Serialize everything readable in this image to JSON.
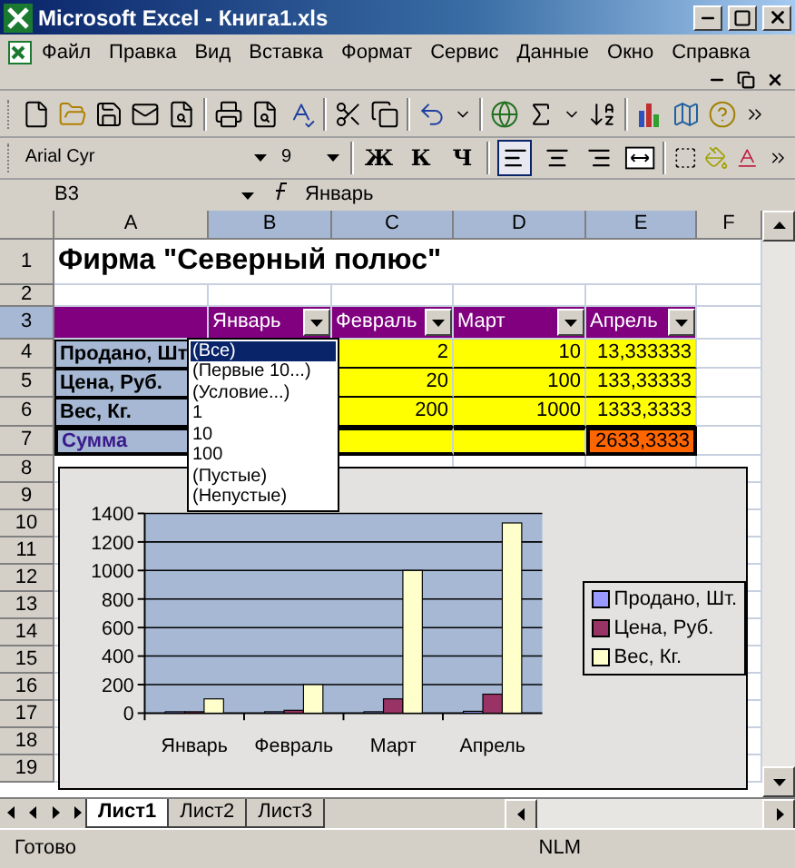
{
  "window": {
    "title": "Microsoft Excel - Книга1.xls"
  },
  "menu": [
    "Файл",
    "Правка",
    "Вид",
    "Вставка",
    "Формат",
    "Сервис",
    "Данные",
    "Окно",
    "Справка"
  ],
  "format_toolbar": {
    "font": "Arial Cyr",
    "size": "9",
    "style_buttons": [
      "Ж",
      "К",
      "Ч"
    ],
    "align": [
      {
        "kind": "left",
        "selected": true
      },
      {
        "kind": "center",
        "selected": false
      },
      {
        "kind": "right",
        "selected": false
      }
    ]
  },
  "formula_bar": {
    "name_box": "B3",
    "value": "Январь"
  },
  "sheet": {
    "columns": [
      {
        "label": "A",
        "selected": false
      },
      {
        "label": "B",
        "selected": true
      },
      {
        "label": "C",
        "selected": true
      },
      {
        "label": "D",
        "selected": true
      },
      {
        "label": "E",
        "selected": true
      },
      {
        "label": "F",
        "selected": false
      }
    ],
    "rows": [
      {
        "number": "1",
        "selected": false,
        "cells": [
          {
            "kind": "title",
            "text": "Фирма \"Северный полюс\""
          }
        ]
      },
      {
        "number": "2",
        "selected": false
      },
      {
        "number": "3",
        "selected": true,
        "cells": [
          {
            "kind": "header-fill"
          },
          {
            "kind": "filter-header",
            "text": "Январь"
          },
          {
            "kind": "filter-header",
            "text": "Февраль"
          },
          {
            "kind": "filter-header",
            "text": "Март"
          },
          {
            "kind": "filter-header",
            "text": "Апрель"
          }
        ]
      },
      {
        "number": "4",
        "selected": false,
        "cells": [
          {
            "kind": "label",
            "text": "Продано, Шт"
          },
          {
            "kind": "covered"
          },
          {
            "kind": "value",
            "text": "2"
          },
          {
            "kind": "value",
            "text": "10"
          },
          {
            "kind": "value",
            "text": "13,333333"
          }
        ]
      },
      {
        "number": "5",
        "selected": false,
        "cells": [
          {
            "kind": "label",
            "text": "Цена, Руб."
          },
          {
            "kind": "covered"
          },
          {
            "kind": "value",
            "text": "20"
          },
          {
            "kind": "value",
            "text": "100"
          },
          {
            "kind": "value",
            "text": "133,33333"
          }
        ]
      },
      {
        "number": "6",
        "selected": false,
        "cells": [
          {
            "kind": "label",
            "text": "Вес, Кг."
          },
          {
            "kind": "covered"
          },
          {
            "kind": "value",
            "text": "200"
          },
          {
            "kind": "value",
            "text": "1000"
          },
          {
            "kind": "value",
            "text": "1333,3333"
          }
        ]
      },
      {
        "number": "7",
        "selected": false,
        "cells": [
          {
            "kind": "sum-label",
            "text": "Сумма"
          },
          {
            "kind": "covered"
          },
          {
            "kind": "sum-fill"
          },
          {
            "kind": "sum-fill"
          },
          {
            "kind": "sum-value",
            "text": "2633,3333"
          }
        ]
      },
      {
        "number": "8",
        "selected": false
      },
      {
        "number": "9",
        "selected": false
      },
      {
        "number": "10",
        "selected": false
      },
      {
        "number": "11",
        "selected": false
      },
      {
        "number": "12",
        "selected": false
      },
      {
        "number": "13",
        "selected": false
      },
      {
        "number": "14",
        "selected": false
      },
      {
        "number": "15",
        "selected": false
      },
      {
        "number": "16",
        "selected": false
      },
      {
        "number": "17",
        "selected": false
      },
      {
        "number": "18",
        "selected": false
      },
      {
        "number": "19",
        "selected": false
      }
    ]
  },
  "autofilter_list": {
    "items": [
      {
        "text": "(Все)",
        "selected": true
      },
      {
        "text": "(Первые 10...)",
        "selected": false
      },
      {
        "text": "(Условие...)",
        "selected": false
      },
      {
        "text": "1",
        "selected": false
      },
      {
        "text": "10",
        "selected": false
      },
      {
        "text": "100",
        "selected": false
      },
      {
        "text": "(Пустые)",
        "selected": false
      },
      {
        "text": "(Непустые)",
        "selected": false
      }
    ]
  },
  "chart": {
    "chart_data": {
      "type": "bar",
      "categories": [
        "Январь",
        "Февраль",
        "Март",
        "Апрель"
      ],
      "series": [
        {
          "name": "Продано, Шт.",
          "color": "#9999ff",
          "values": [
            1,
            2,
            10,
            13
          ]
        },
        {
          "name": "Цена, Руб.",
          "color": "#993366",
          "values": [
            10,
            20,
            100,
            133
          ]
        },
        {
          "name": "Вес, Кг.",
          "color": "#ffffcc",
          "values": [
            100,
            200,
            1000,
            1333
          ]
        }
      ],
      "grid": true,
      "legend": "right",
      "ylim": [
        0,
        1400
      ],
      "yticks": [
        0,
        200,
        400,
        600,
        800,
        1000,
        1200,
        1400
      ]
    }
  },
  "sheet_tabs": [
    {
      "label": "Лист1",
      "selected": true
    },
    {
      "label": "Лист2",
      "selected": false
    },
    {
      "label": "Лист3",
      "selected": false
    }
  ],
  "status_bar": {
    "state": "Готово",
    "indicator": "NLM"
  }
}
